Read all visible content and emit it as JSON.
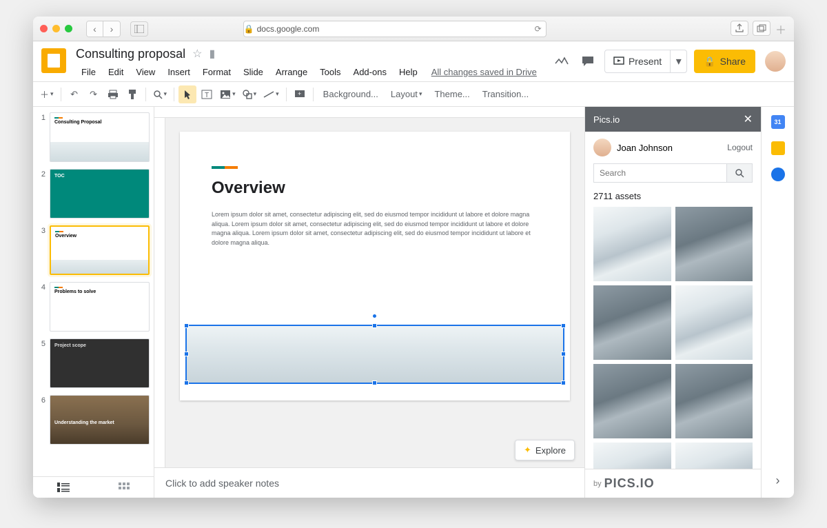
{
  "browser": {
    "url": "docs.google.com"
  },
  "doc": {
    "title": "Consulting proposal",
    "saved_status": "All changes saved in Drive"
  },
  "menu": [
    "File",
    "Edit",
    "View",
    "Insert",
    "Format",
    "Slide",
    "Arrange",
    "Tools",
    "Add-ons",
    "Help"
  ],
  "header_buttons": {
    "present": "Present",
    "share": "Share"
  },
  "toolbar": {
    "background": "Background...",
    "layout": "Layout",
    "theme": "Theme...",
    "transition": "Transition..."
  },
  "thumbnails": [
    {
      "n": "1",
      "title": "Consulting Proposal"
    },
    {
      "n": "2",
      "title": "TOC"
    },
    {
      "n": "3",
      "title": "Overview"
    },
    {
      "n": "4",
      "title": "Problems to solve"
    },
    {
      "n": "5",
      "title": "Project scope"
    },
    {
      "n": "6",
      "title": "Understanding the market"
    }
  ],
  "slide": {
    "heading": "Overview",
    "body": "Lorem ipsum dolor sit amet, consectetur adipiscing elit, sed do eiusmod tempor incididunt ut labore et dolore magna aliqua. Lorem ipsum dolor sit amet, consectetur adipiscing elit, sed do eiusmod tempor incididunt ut labore et dolore magna aliqua. Lorem ipsum dolor sit amet, consectetur adipiscing elit, sed do eiusmod tempor incididunt ut labore et dolore magna aliqua."
  },
  "notes_placeholder": "Click to add speaker notes",
  "explore_label": "Explore",
  "picsio": {
    "title": "Pics.io",
    "user": "Joan Johnson",
    "logout": "Logout",
    "search_placeholder": "Search",
    "asset_count": "2711 assets",
    "footer_by": "by",
    "footer_brand": "PICS.IO"
  },
  "rail": {
    "calendar_day": "31"
  }
}
